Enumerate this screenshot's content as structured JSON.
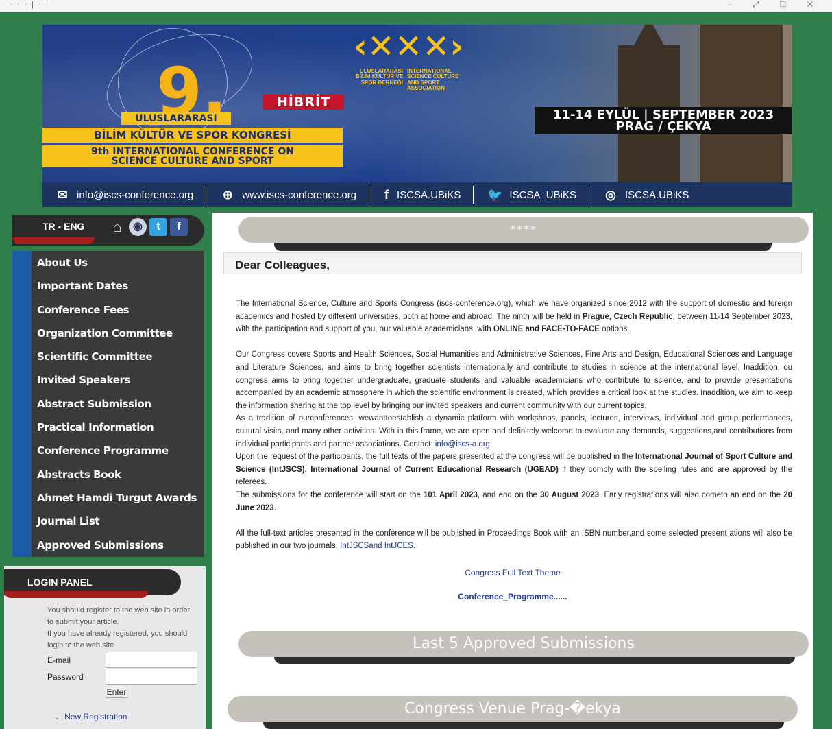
{
  "window": {
    "dots": "· · · | · ·",
    "controls": "– ⤢ ☐ ✕"
  },
  "banner": {
    "number": "9.",
    "hibrit": "HİBRİT",
    "line1": "ULUSLARARASI",
    "line2": "BİLİM KÜLTÜR VE SPOR KONGRESİ",
    "line3": "9th INTERNATIONAL CONFERENCE ON",
    "line4": "SCIENCE CULTURE AND SPORT",
    "logo_mark": "‹✕✕✕›",
    "logo_left": "ULUSLARARASI BİLİM KÜLTÜR VE SPOR DERNEĞİ",
    "logo_right": "INTERNATIONAL SCIENCE CULTURE AND SPORT ASSOCIATION",
    "date_line1": "11-14 EYLÜL | SEPTEMBER 2023",
    "date_line2": "PRAG / ÇEKYA"
  },
  "contact": {
    "email": "info@iscs-conference.org",
    "web": "www.iscs-conference.org",
    "facebook": "ISCSA.UBiKS",
    "twitter": "ISCSA_UBiKS",
    "instagram": "ISCSA.UBiKS"
  },
  "lang": {
    "label": "TR - ENG"
  },
  "menu": {
    "items": [
      "About Us",
      "Important Dates",
      "Conference Fees",
      "Organization Committee",
      "Scientific Committee",
      "Invited Speakers",
      "Abstract Submission",
      "Practical Information",
      "Conference Programme",
      "Abstracts Book",
      "Ahmet Hamdi Turgut Awards",
      "Journal List",
      "Approved Submissions"
    ]
  },
  "login": {
    "title": "LOGIN PANEL",
    "info1": "You should register to the web site in order to submit your article.",
    "info2": "If you have already registered, you should login to the web site",
    "email_label": "E-mail",
    "password_label": "Password",
    "enter": "Enter",
    "new_registration": "New Registration"
  },
  "main": {
    "top_pill": "****",
    "heading": "Dear Colleagues,",
    "p1a": "The International Science, Culture and Sports Congress (iscs-conference.org), which we have organized since 2012 with the support of domestic and foreign academics and hosted by different universities, both at home and abroad. The ninth will be held in ",
    "p1b": "Prague, Czech Republic",
    "p1c": ", between 11-14 September 2023, with the participation and support of you, our valuable academicians, with ",
    "p1d": "ONLINE and FACE-TO-FACE",
    "p1e": " options.",
    "p2": "Our Congress covers Sports and Health Sciences, Social Humanities and Administrative Sciences, Fine Arts and Design, Educational Sciences and Language and Literature Sciences, and aims to bring together scientists internationally and contribute to studies in science at the international level. Inaddition, ou congress aims to bring together undergraduate, graduate students and valuable academicians who contribute to science, and to provide presentations accompanied by an academic atmosphere in which the scientific environment is created, which provides a critical look at the studies. Inaddition, we aim to keep the information sharing at the top level by bringing our invited speakers and current community with our current topics.",
    "p3a": "As a tradition of ourconferences, wewanttoestablish a dynamic platform with workshops, panels, lectures, interviews, individual and group performances, cultural visits, and many other activities. With in this frame, we are open and definitely welcome to evaluate any demands, suggestions,and contributions from individual participants and partner associations. Contact: ",
    "p3b": "info@iscs-a.org",
    "p4a": "Upon the request of the participants, the full texts of the papers presented at the congress will be published in the ",
    "p4b": "International Journal of Sport Culture and Science (IntJSCS), International Journal of Current Educational Research (UGEAD)",
    "p4c": "  if they comply with the spelling rules and are approved by the referees.",
    "p5a": "The submissions for the conference will start on the ",
    "p5b": "101 April 2023",
    "p5c": ", and end on the ",
    "p5d": "30 August 2023",
    "p5e": ". Early registrations will also cometo an end on the ",
    "p5f": "20 June 2023",
    "p5g": ".",
    "p6a": "All the full-text articles presented in the conference will be published in Proceedings Book with an ISBN number,and some selected present ations will also be published in our two journals; ",
    "p6b": "IntJSCSand  IntJCES",
    "p6c": ".",
    "full_text": "Congress Full Text Theme",
    "programme": "Conference_Programme......",
    "pill2": "Last 5 Approved Submissions",
    "pill3": "Congress Venue Prag-�ekya"
  },
  "colors": {
    "frame": "#2f7e4b",
    "banner": "#1d3f8c",
    "yellow": "#f6c21b",
    "red": "#c5162d",
    "menu": "#3a3a3a",
    "menu_accent": "#1b5aa6"
  }
}
